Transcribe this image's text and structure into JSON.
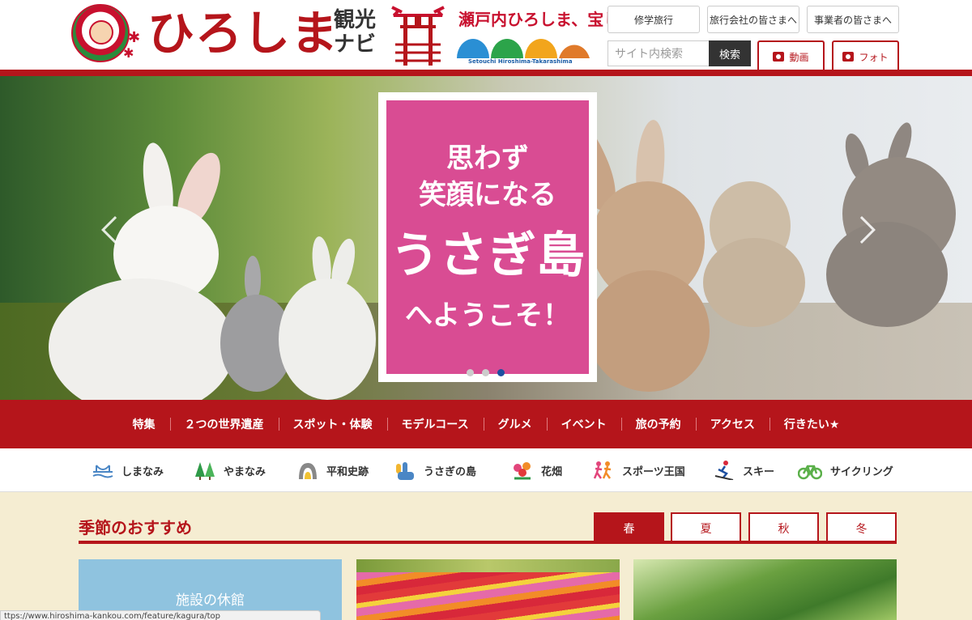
{
  "header": {
    "logo_text": "ひろしま",
    "logo_sub": "観光ナビ",
    "setouchi_title": "瀬戸内ひろしま、宝しま",
    "setouchi_small": "Setouchi Hiroshima-Takarashima",
    "top_links": [
      {
        "label": "修学旅行"
      },
      {
        "label": "旅行会社の皆さまへ"
      },
      {
        "label": "事業者の皆さまへ"
      }
    ],
    "search": {
      "placeholder": "サイト内検索",
      "button": "検索"
    },
    "media": [
      {
        "label": "動画",
        "icon": "video-icon"
      },
      {
        "label": "フォト",
        "icon": "camera-icon"
      }
    ],
    "brand_color": "#b5151b"
  },
  "hero": {
    "panel_lines": [
      "思わず",
      "笑顔になる",
      "うさぎ島",
      "へようこそ！"
    ],
    "panel_color": "#d94c93",
    "slide_count": 3,
    "active_slide": 3
  },
  "main_nav": [
    {
      "label": "特集"
    },
    {
      "label": "２つの世界遺産"
    },
    {
      "label": "スポット・体験"
    },
    {
      "label": "モデルコース"
    },
    {
      "label": "グルメ"
    },
    {
      "label": "イベント"
    },
    {
      "label": "旅の予約"
    },
    {
      "label": "アクセス"
    },
    {
      "label": "行きたい★"
    }
  ],
  "sub_nav": [
    {
      "label": "しまなみ",
      "icon": "bridge-icon"
    },
    {
      "label": "やまなみ",
      "icon": "trees-icon"
    },
    {
      "label": "平和史跡",
      "icon": "peace-arch-icon"
    },
    {
      "label": "うさぎの島",
      "icon": "rabbit-icon"
    },
    {
      "label": "花畑",
      "icon": "flower-icon"
    },
    {
      "label": "スポーツ王国",
      "icon": "runners-icon"
    },
    {
      "label": "スキー",
      "icon": "skier-icon"
    },
    {
      "label": "サイクリング",
      "icon": "bicycle-icon"
    }
  ],
  "seasonal": {
    "title": "季節のおすすめ",
    "tabs": [
      {
        "label": "春",
        "active": true
      },
      {
        "label": "夏",
        "active": false
      },
      {
        "label": "秋",
        "active": false
      },
      {
        "label": "冬",
        "active": false
      }
    ],
    "cards": [
      {
        "label": "施設の休館"
      }
    ]
  },
  "status_bar": {
    "url": "ttps://www.hiroshima-kankou.com/feature/kagura/top"
  }
}
